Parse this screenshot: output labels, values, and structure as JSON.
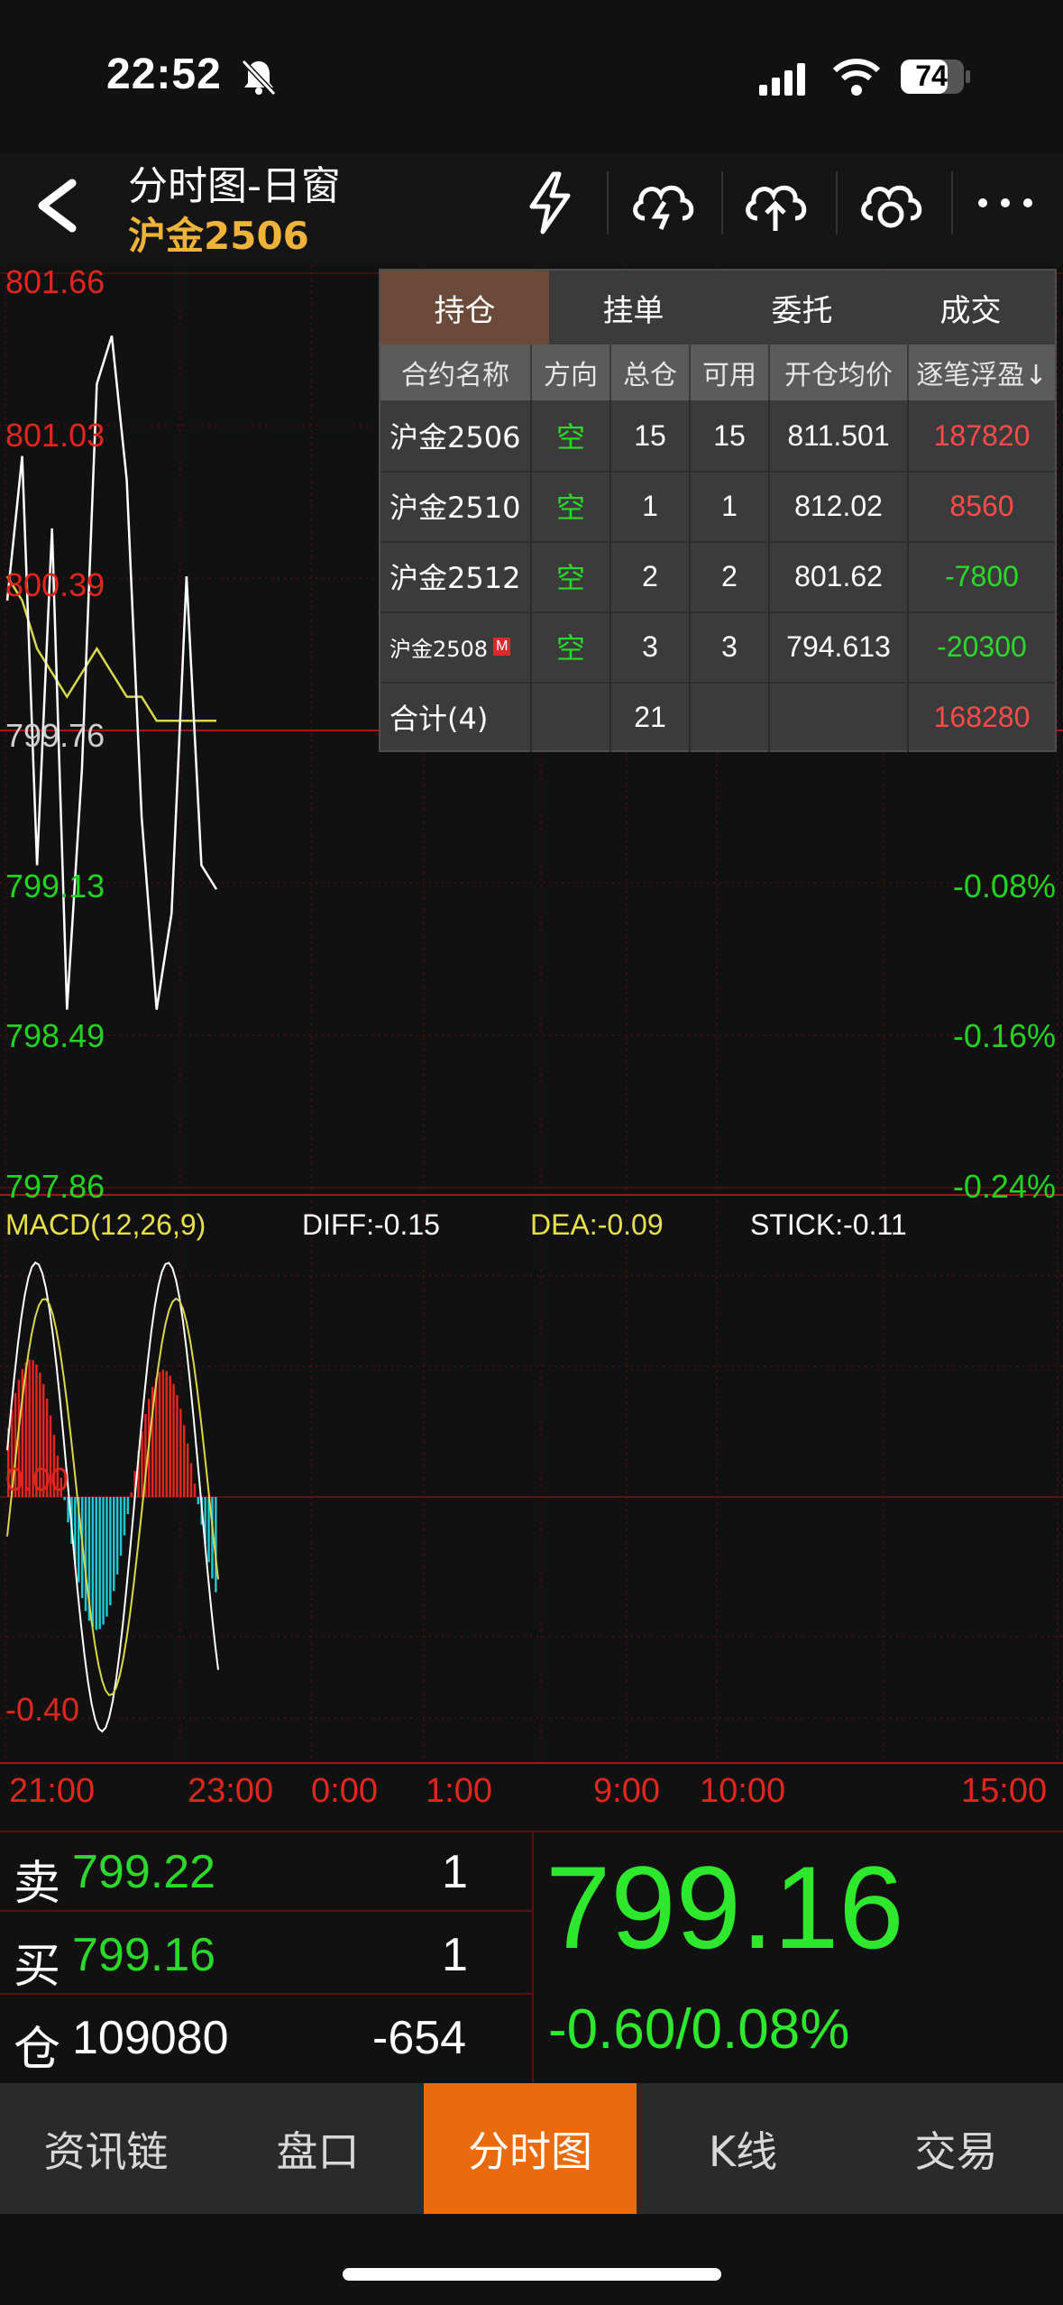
{
  "status_bar": {
    "time": "22:52",
    "battery": "74"
  },
  "header": {
    "title": "分时图-日窗",
    "subtitle": "沪金2506",
    "icons": [
      "lightning-icon",
      "cloud-lightning-icon",
      "cloud-upload-icon",
      "cloud-sync-icon",
      "more-icon"
    ]
  },
  "chart": {
    "price_labels": [
      "801.66",
      "801.03",
      "800.39",
      "799.76",
      "799.13",
      "798.49",
      "797.86"
    ],
    "pct_labels": [
      "-0.08%",
      "-0.16%",
      "-0.24%"
    ],
    "macd": {
      "title": "MACD(12,26,9)",
      "diff": "DIFF:-0.15",
      "dea": "DEA:-0.09",
      "stick": "STICK:-0.11",
      "zero": "0.00",
      "low": "-0.40"
    },
    "time_labels": [
      "21:00",
      "23:00",
      "0:00",
      "1:00",
      "9:00",
      "10:00",
      "15:00"
    ],
    "colors": {
      "up": "#e0261f",
      "down": "#22d322",
      "price_line": "#ffffff",
      "avg_line": "#d8d84a",
      "macd_neg": "#1ec8d0",
      "grid": "#6a1010"
    }
  },
  "chart_data": {
    "type": "line",
    "title": "",
    "xlabel": "",
    "ylabel": "",
    "ylim": [
      797.86,
      801.66
    ],
    "x_ticks": [
      "21:00",
      "23:00",
      "0:00",
      "1:00",
      "9:00",
      "10:00",
      "15:00"
    ],
    "series": [
      {
        "values": [
          800.3,
          800.9,
          799.2,
          800.6,
          798.6,
          799.6,
          801.2,
          801.4,
          800.8,
          799.4,
          798.6,
          799.0,
          800.4,
          799.2,
          799.1
        ]
      },
      {
        "values": [
          800.4,
          800.3,
          800.1,
          800.0,
          799.9,
          800.0,
          800.1,
          800.0,
          799.9,
          799.9,
          799.8,
          799.8,
          799.8,
          799.8,
          799.8
        ]
      }
    ]
  },
  "positions": {
    "tabs": [
      "持仓",
      "挂单",
      "委托",
      "成交"
    ],
    "headers": [
      "合约名称",
      "方向",
      "总仓",
      "可用",
      "开仓均价",
      "逐笔浮盈↓"
    ],
    "rows": [
      {
        "name": "沪金2506",
        "dir": "空",
        "total": "15",
        "avail": "15",
        "price": "811.501",
        "pnl": "187820",
        "pnl_color": "#ff4a4a",
        "badge": ""
      },
      {
        "name": "沪金2510",
        "dir": "空",
        "total": "1",
        "avail": "1",
        "price": "812.02",
        "pnl": "8560",
        "pnl_color": "#ff4a4a",
        "badge": ""
      },
      {
        "name": "沪金2512",
        "dir": "空",
        "total": "2",
        "avail": "2",
        "price": "801.62",
        "pnl": "-7800",
        "pnl_color": "#2bd82b",
        "badge": ""
      },
      {
        "name": "沪金2508",
        "dir": "空",
        "total": "3",
        "avail": "3",
        "price": "794.613",
        "pnl": "-20300",
        "pnl_color": "#2bd82b",
        "badge": "M"
      }
    ],
    "total": {
      "label": "合计(4)",
      "total": "21",
      "pnl": "168280"
    }
  },
  "quote": {
    "sell_label": "卖",
    "sell_price": "799.22",
    "sell_qty": "1",
    "buy_label": "买",
    "buy_price": "799.16",
    "buy_qty": "1",
    "oi_label": "仓",
    "oi_value": "109080",
    "oi_change": "-654",
    "last_price": "799.16",
    "change": "-0.60/0.08%"
  },
  "nav": {
    "items": [
      "资讯链",
      "盘口",
      "分时图",
      "K线",
      "交易"
    ],
    "active_index": 2
  }
}
